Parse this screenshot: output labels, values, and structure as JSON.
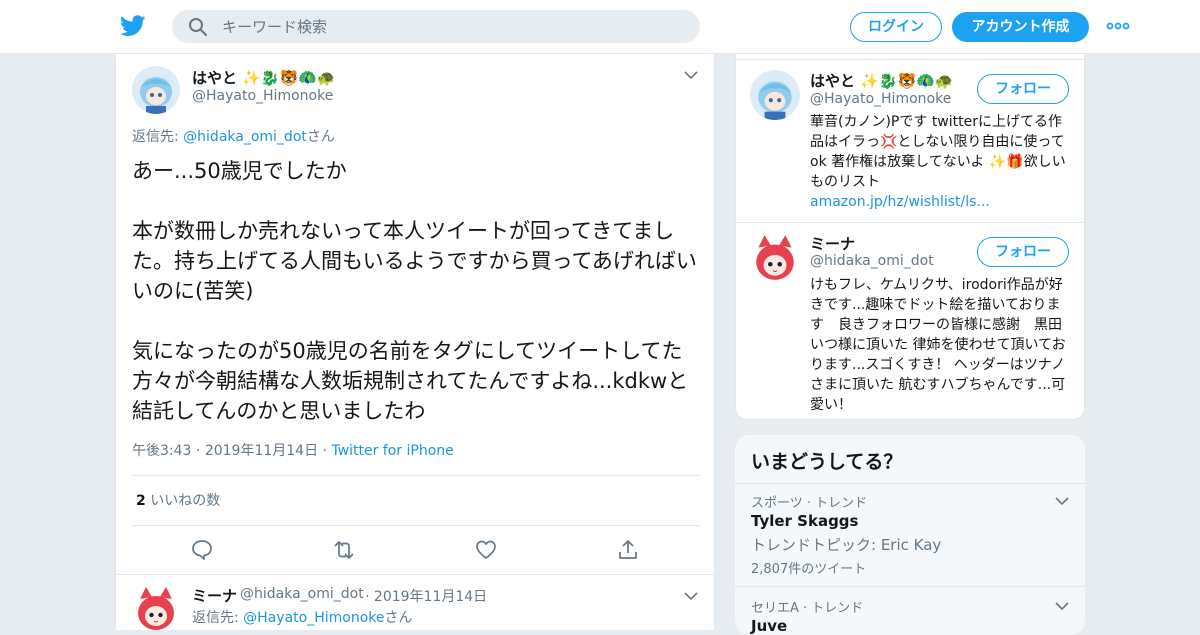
{
  "header": {
    "search_placeholder": "キーワード検索",
    "login_label": "ログイン",
    "signup_label": "アカウント作成",
    "brand_color": "#1da1f2"
  },
  "tweet": {
    "author_name": "はやと ✨🐉🐯🦚🐢",
    "author_handle": "@Hayato_Himonoke",
    "reply_prefix": "返信先: ",
    "reply_handle": "@hidaka_omi_dot",
    "reply_suffix": "さん",
    "text": "あー...50歳児でしたか\n\n本が数冊しか売れないって本人ツイートが回ってきてました。持ち上げてる人間もいるようですから買ってあげればいいのに(苦笑)\n\n気になったのが50歳児の名前をタグにしてツイートしてた方々が今朝結構な人数垢規制されてたんですよね...kdkwと結託してんのかと思いましたわ",
    "time": "午後3:43",
    "date": "2019年11月14日",
    "source": "Twitter for iPhone",
    "likes_count": "2",
    "likes_label": "いいねの数"
  },
  "reply": {
    "author_name": "ミーナ",
    "author_handle": "@hidaka_omi_dot",
    "date": "2019年11月14日",
    "reply_prefix": "返信先: ",
    "reply_handle": "@Hayato_Himonoke",
    "reply_suffix": "さん"
  },
  "sidebar_users": [
    {
      "name": "はやと ✨🐉🐯🦚🐢",
      "handle": "@Hayato_Himonoke",
      "follow_label": "フォロー",
      "bio": "華音(カノン)Pです twitterに上げてる作品はイラっ💢としない限り自由に使ってok 著作権は放棄してないよ ✨🎁欲しいものリスト",
      "bio_link": "amazon.jp/hz/wishlist/ls..."
    },
    {
      "name": "ミーナ",
      "handle": "@hidaka_omi_dot",
      "follow_label": "フォロー",
      "bio": "けもフレ、ケムリクサ、irodori作品が好きです...趣味でドット絵を描いております　良きフォロワーの皆様に感謝　黒田いつ様に頂いた 律姉を使わせて頂いております...スゴくすき！ ヘッダーはツナノさまに頂いた 航むすハブちゃんです...可愛い！"
    }
  ],
  "trends": {
    "title": "いまどうしてる？",
    "items": [
      {
        "category": "スポーツ · トレンド",
        "name": "Tyler Skaggs",
        "topic": "トレンドトピック: Eric Kay",
        "count": "2,807件のツイート"
      },
      {
        "category": "セリエA · トレンド",
        "name": "Juve"
      }
    ]
  }
}
